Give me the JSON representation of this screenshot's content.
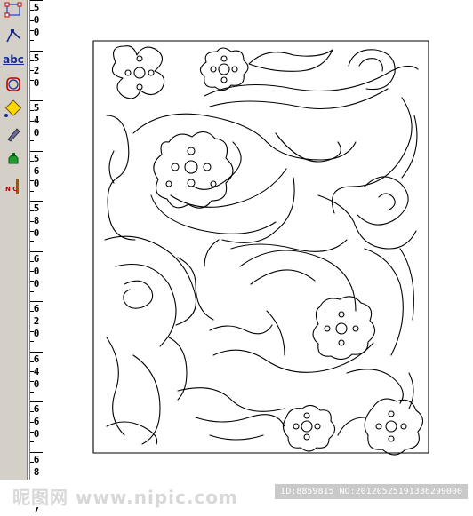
{
  "toolbar": {
    "tools": [
      {
        "icon": "node-select-icon"
      },
      {
        "icon": "direct-select-icon"
      },
      {
        "icon": "text-tool-icon",
        "label": "abc"
      },
      {
        "icon": "shape-tool-icon"
      },
      {
        "icon": "rotate-tool-icon"
      },
      {
        "icon": "pen-tool-icon"
      },
      {
        "icon": "fill-bucket-icon"
      },
      {
        "icon": "nc-output-icon",
        "label": "N C"
      }
    ]
  },
  "ruler": {
    "labels": [
      {
        "digits": [
          "5",
          "0",
          "0"
        ]
      },
      {
        "digits": [
          "5",
          "2",
          "0"
        ]
      },
      {
        "digits": [
          "5",
          "4",
          "0"
        ]
      },
      {
        "digits": [
          "5",
          "6",
          "0"
        ]
      },
      {
        "digits": [
          "5",
          "8",
          "0"
        ]
      },
      {
        "digits": [
          "6",
          "0",
          "0"
        ]
      },
      {
        "digits": [
          "6",
          "2",
          "0"
        ]
      },
      {
        "digits": [
          "6",
          "4",
          "0"
        ]
      },
      {
        "digits": [
          "6",
          "6",
          "0"
        ]
      },
      {
        "digits": [
          "6",
          "8",
          "0"
        ]
      },
      {
        "digits": [
          "7"
        ]
      }
    ]
  },
  "canvas": {
    "line_color": "#000000",
    "background": "#ffffff"
  },
  "watermark": {
    "site": "昵图网 www.nipic.com",
    "id_text": "ID:8859815 NO:20120525191336299000"
  }
}
